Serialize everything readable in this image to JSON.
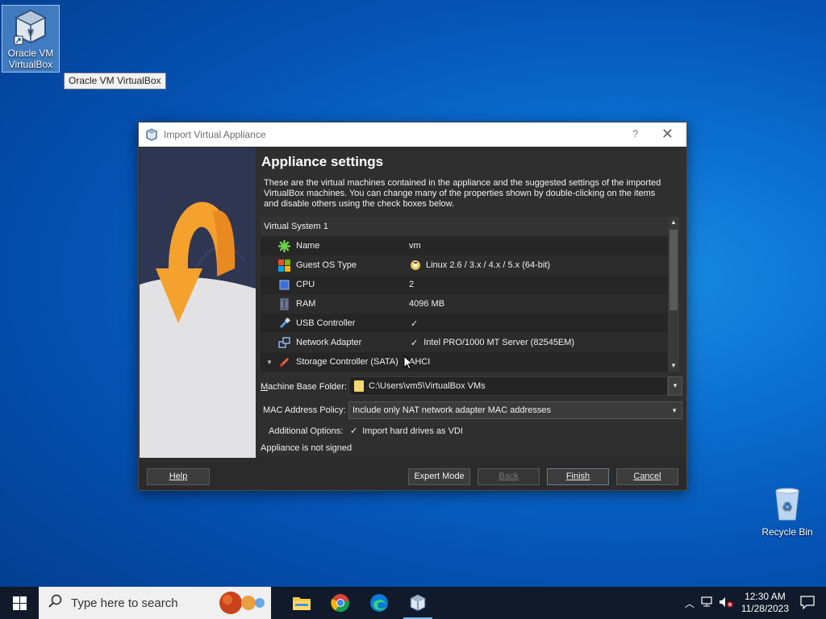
{
  "desktop": {
    "vbox_icon_label_line1": "Oracle VM",
    "vbox_icon_label_line2": "VirtualBox",
    "tooltip": "Oracle VM VirtualBox",
    "recycle_label": "Recycle Bin"
  },
  "dialog": {
    "title": "Import Virtual Appliance",
    "help_glyph": "?",
    "close_glyph": "✕",
    "heading": "Appliance settings",
    "description": "These are the virtual machines contained in the appliance and the suggested settings of the imported VirtualBox machines. You can change many of the properties shown by double-clicking on the items and disable others using the check boxes below.",
    "tree": {
      "group": "Virtual System 1",
      "rows": [
        {
          "label": "Name",
          "value": "vm",
          "icon": "name-icon"
        },
        {
          "label": "Guest OS Type",
          "value": "Linux 2.6 / 3.x / 4.x / 5.x (64-bit)",
          "icon": "os-icon"
        },
        {
          "label": "CPU",
          "value": "2",
          "icon": "cpu-icon"
        },
        {
          "label": "RAM",
          "value": "4096 MB",
          "icon": "ram-icon"
        },
        {
          "label": "USB Controller",
          "value": "✓",
          "icon": "usb-icon"
        },
        {
          "label": "Network Adapter",
          "value": "Intel PRO/1000 MT Server (82545EM)",
          "check": "✓",
          "icon": "network-icon"
        },
        {
          "label": "Storage Controller (SATA)",
          "value": "AHCI",
          "icon": "storage-icon"
        }
      ]
    },
    "base_folder_label_u": "M",
    "base_folder_label_rest": "achine Base Folder:",
    "base_folder_value": "C:\\Users\\vm5\\VirtualBox VMs",
    "mac_policy_label": "MAC Address Policy:",
    "mac_policy_value": "Include only NAT network adapter MAC addresses",
    "additional_options_label": "Additional Options:",
    "import_vdi_check": "✓",
    "import_vdi_label": "Import hard drives as VDI",
    "signed_status": "Appliance is not signed",
    "buttons": {
      "help": "Help",
      "expert": "Expert Mode",
      "back": "Back",
      "finish": "Finish",
      "cancel": "Cancel"
    }
  },
  "taskbar": {
    "search_placeholder": "Type here to search",
    "time": "12:30 AM",
    "date": "11/28/2023"
  },
  "colors": {
    "accent": "#76b9ed",
    "dialog_bg": "#2f2f2f",
    "arrow_orange": "#f5a12e"
  }
}
